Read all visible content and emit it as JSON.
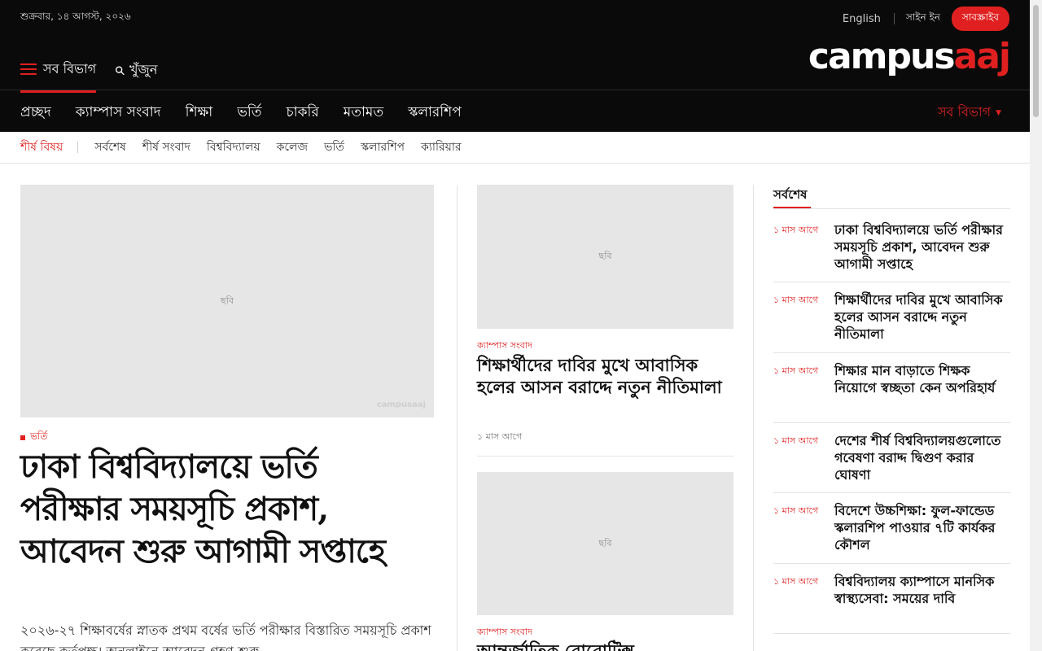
{
  "header": {
    "date": "শুক্রবার, ১৪ আগস্ট, ২০২৬",
    "lang": "English",
    "signin": "সাইন ইন",
    "subscribe": "সাবস্ক্রাইব",
    "all_sections": "সব বিভাগ",
    "search": "খুঁজুন",
    "logo_part1": "campus",
    "logo_part2": "aaj"
  },
  "main_nav": [
    "প্রচ্ছদ",
    "ক্যাম্পাস সংবাদ",
    "শিক্ষা",
    "ভর্তি",
    "চাকরি",
    "মতামত",
    "স্কলারশিপ"
  ],
  "main_nav_right": "সব বিভাগ",
  "sub_nav": {
    "hot_label": "শীর্ষ বিষয়",
    "items": [
      "সর্বশেষ",
      "শীর্ষ সংবাদ",
      "বিশ্ববিদ্যালয়",
      "কলেজ",
      "ভর্তি",
      "স্কলারশিপ",
      "ক্যারিয়ার"
    ]
  },
  "image_placeholder": "ছবি",
  "watermark": "campusaaj",
  "lead": {
    "category": "ভর্তি",
    "title": "ঢাকা বিশ্ববিদ্যালয়ে ভর্তি পরীক্ষার সময়সূচি প্রকাশ, আবেদন শুরু আগামী সপ্তাহে",
    "summary": "২০২৬-২৭ শিক্ষাবর্ষের স্নাতক প্রথম বর্ষের ভর্তি পরীক্ষার বিস্তারিত সময়সূচি প্রকাশ করেছে কর্তৃপক্ষ। অনলাইনে আবেদন গ্রহণ শুরু"
  },
  "col2": [
    {
      "category": "ক্যাম্পাস সংবাদ",
      "title": "শিক্ষার্থীদের দাবির মুখে আবাসিক হলের আসন বরাদ্দে নতুন নীতিমালা",
      "time": "১ মাস আগে"
    },
    {
      "category": "ক্যাম্পাস সংবাদ",
      "title": "আন্তর্জাতিক রোবোটিক্স"
    }
  ],
  "latest": {
    "heading": "সর্বশেষ",
    "items": [
      {
        "time": "১ মাস আগে",
        "title": "ঢাকা বিশ্ববিদ্যালয়ে ভর্তি পরীক্ষার সময়সূচি প্রকাশ, আবেদন শুরু আগামী সপ্তাহে"
      },
      {
        "time": "১ মাস আগে",
        "title": "শিক্ষার্থীদের দাবির মুখে আবাসিক হলের আসন বরাদ্দে নতুন নীতিমালা"
      },
      {
        "time": "১ মাস আগে",
        "title": "শিক্ষার মান বাড়াতে শিক্ষক নিয়োগে স্বচ্ছতা কেন অপরিহার্য"
      },
      {
        "time": "১ মাস আগে",
        "title": "দেশের শীর্ষ বিশ্ববিদ্যালয়গুলোতে গবেষণা বরাদ্দ দ্বিগুণ করার ঘোষণা"
      },
      {
        "time": "১ মাস আগে",
        "title": "বিদেশে উচ্চশিক্ষা: ফুল-ফান্ডেড স্কলারশিপ পাওয়ার ৭টি কার্যকর কৌশল"
      },
      {
        "time": "১ মাস আগে",
        "title": "বিশ্ববিদ্যালয় ক্যাম্পাসে মানসিক স্বাস্থ্যসেবা: সময়ের দাবি"
      }
    ]
  },
  "colors": {
    "accent": "#e02020",
    "header_bg": "#0a0a0a"
  }
}
